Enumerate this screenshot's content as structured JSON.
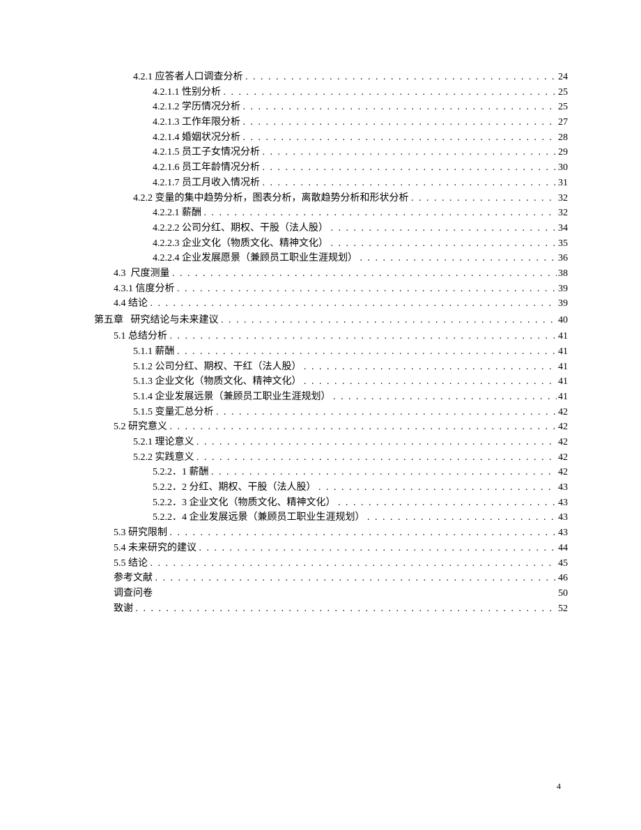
{
  "toc": [
    {
      "indent": 2,
      "title": "4.2.1 应答者人口调查分析",
      "page": "24"
    },
    {
      "indent": 3,
      "title": "4.2.1.1 性别分析",
      "page": "25"
    },
    {
      "indent": 3,
      "title": "4.2.1.2 学历情况分析",
      "page": "25"
    },
    {
      "indent": 3,
      "title": "4.2.1.3 工作年限分析",
      "page": "27"
    },
    {
      "indent": 3,
      "title": "4.2.1.4 婚姻状况分析",
      "page": "28"
    },
    {
      "indent": 3,
      "title": "4.2.1.5 员工子女情况分析",
      "page": "29"
    },
    {
      "indent": 3,
      "title": "4.2.1.6 员工年龄情况分析",
      "page": "30"
    },
    {
      "indent": 3,
      "title": "4.2.1.7 员工月收入情况析",
      "page": "31"
    },
    {
      "indent": 2,
      "title": "4.2.2 变量的集中趋势分析，图表分析，离散趋势分析和形状分析",
      "page": "32"
    },
    {
      "indent": 3,
      "title": "4.2.2.1 薪酬",
      "page": "32"
    },
    {
      "indent": 3,
      "title": "4.2.2.2 公司分红、期权、干股（法人股）",
      "page": "34"
    },
    {
      "indent": 3,
      "title": "4.2.2.3 企业文化（物质文化、精神文化）",
      "page": "35"
    },
    {
      "indent": 3,
      "title": "4.2.2.4 企业发展愿景（兼顾员工职业生涯规划）",
      "page": "36"
    },
    {
      "indent": 1,
      "title": "4.3  尺度测量",
      "page": "38"
    },
    {
      "indent": 1,
      "title": "4.3.1 信度分析",
      "page": "39"
    },
    {
      "indent": 1,
      "title": "4.4 结论",
      "page": "39"
    },
    {
      "indent": 0,
      "title": "第五章   研究结论与未来建议",
      "page": "40",
      "chapter": true
    },
    {
      "indent": 1,
      "title": "5.1 总结分析",
      "page": "41"
    },
    {
      "indent": 2,
      "title": "5.1.1 薪酬",
      "page": "41"
    },
    {
      "indent": 2,
      "title": "5.1.2 公司分红、期权、干红（法人股）",
      "page": "41"
    },
    {
      "indent": 2,
      "title": "5.1.3 企业文化（物质文化、精神文化）",
      "page": "41"
    },
    {
      "indent": 2,
      "title": "5.1.4 企业发展远景（兼顾员工职业生涯规划）",
      "page": "41"
    },
    {
      "indent": 2,
      "title": "5.1.5 变量汇总分析",
      "page": "42"
    },
    {
      "indent": 1,
      "title": "5.2 研究意义",
      "page": "42"
    },
    {
      "indent": 2,
      "title": "5.2.1 理论意义",
      "page": "42"
    },
    {
      "indent": 2,
      "title": "5.2.2 实践意义",
      "page": "42"
    },
    {
      "indent": 3,
      "title": "5.2.2．1 薪酬",
      "page": "42"
    },
    {
      "indent": 3,
      "title": "5.2.2．2 分红、期权、干股（法人股）",
      "page": "43"
    },
    {
      "indent": 3,
      "title": "5.2.2．3 企业文化（物质文化、精神文化）",
      "page": "43"
    },
    {
      "indent": 3,
      "title": "5.2.2．4 企业发展远景（兼顾员工职业生涯规划）",
      "page": "43"
    },
    {
      "indent": 1,
      "title": "5.3 研究限制",
      "page": "43"
    },
    {
      "indent": 1,
      "title": "5.4 未来研究的建议",
      "page": "44"
    },
    {
      "indent": 1,
      "title": "5.5 结论",
      "page": "45"
    },
    {
      "indent": 1,
      "title": "参考文献",
      "page": "46"
    },
    {
      "indent": 1,
      "title": "调查问卷",
      "page": "50",
      "nodots": true
    },
    {
      "indent": 1,
      "title": "致谢",
      "page": "52"
    }
  ],
  "page_number": "4"
}
